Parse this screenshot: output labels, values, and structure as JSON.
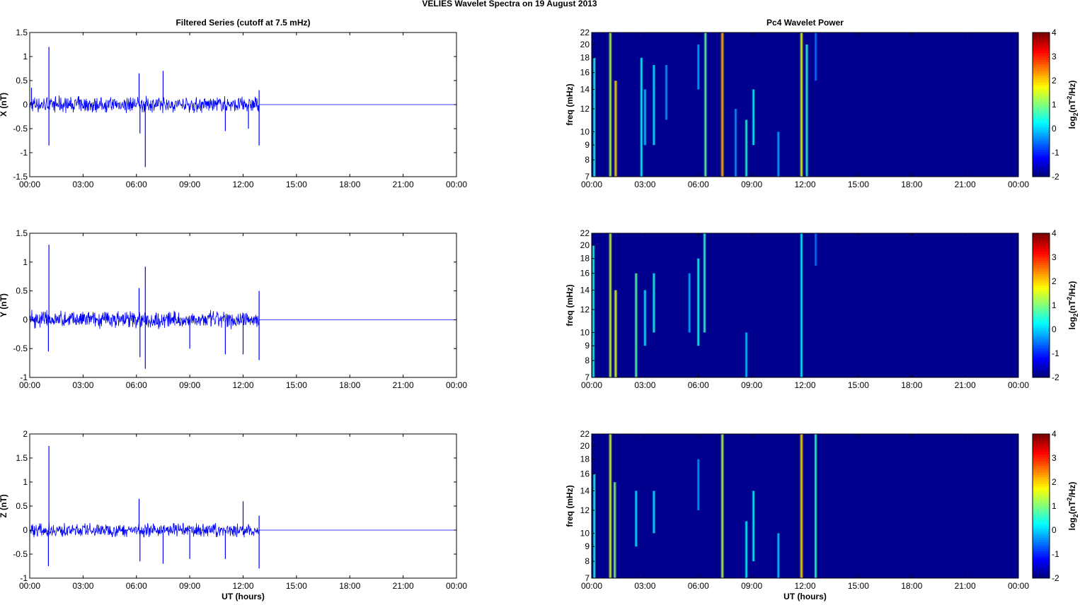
{
  "figure_title": "VELIES Wavelet Spectra on 19 August    2013",
  "chart_data": [
    {
      "type": "line",
      "title": "Filtered Series (cutoff at 7.5 mHz)",
      "ylabel": "X (nT)",
      "xlabel": "",
      "ylim": [
        -1.5,
        1.5
      ],
      "yticks": [
        "-1.5",
        "-1",
        "-0.5",
        "0",
        "0.5",
        "1",
        "1.5"
      ],
      "xlim_hours": [
        0,
        24
      ],
      "xticks": [
        "00:00",
        "03:00",
        "06:00",
        "09:00",
        "12:00",
        "15:00",
        "18:00",
        "21:00",
        "00:00"
      ],
      "data_end_hours": 12.9,
      "noise_amplitude": 0.12,
      "color": "#0000ff",
      "spikes": [
        {
          "t": 1.08,
          "v": 1.2
        },
        {
          "t": 1.08,
          "v": -0.85
        },
        {
          "t": 0.1,
          "v": 0.35
        },
        {
          "t": 6.15,
          "v": 0.65
        },
        {
          "t": 6.2,
          "v": -0.6
        },
        {
          "t": 6.5,
          "v": -1.3
        },
        {
          "t": 7.5,
          "v": 0.7
        },
        {
          "t": 11.0,
          "v": -0.55
        },
        {
          "t": 12.3,
          "v": -0.5
        },
        {
          "t": 12.9,
          "v": -0.85
        },
        {
          "t": 12.9,
          "v": 0.3
        }
      ]
    },
    {
      "type": "heatmap",
      "title": "Pc4 Wavelet Power",
      "ylabel": "freq (mHz)",
      "xlabel": "",
      "ylim_mHz": [
        7,
        22
      ],
      "yticks": [
        "7",
        "8",
        "9",
        "10",
        "12",
        "14",
        "16",
        "18",
        "20",
        "22"
      ],
      "xticks": [
        "00:00",
        "03:00",
        "06:00",
        "09:00",
        "12:00",
        "15:00",
        "18:00",
        "21:00",
        "00:00"
      ],
      "colorbar": {
        "label": "log2(nT2/Hz)",
        "range": [
          -2,
          4
        ],
        "ticks": [
          "-2",
          "-1",
          "0",
          "1",
          "2",
          "3",
          "4"
        ]
      },
      "bursts": [
        {
          "t": 0.15,
          "f0": 7,
          "f1": 18,
          "p": 0.5
        },
        {
          "t": 1.05,
          "f0": 7,
          "f1": 22,
          "p": 1.3
        },
        {
          "t": 1.35,
          "f0": 7,
          "f1": 15,
          "p": 2.0
        },
        {
          "t": 2.8,
          "f0": 7,
          "f1": 18,
          "p": 0.3
        },
        {
          "t": 3.0,
          "f0": 9,
          "f1": 14,
          "p": 0.0
        },
        {
          "t": 3.5,
          "f0": 9,
          "f1": 17,
          "p": 0.2
        },
        {
          "t": 4.2,
          "f0": 11,
          "f1": 17,
          "p": -0.3
        },
        {
          "t": 6.0,
          "f0": 14,
          "f1": 20,
          "p": -0.2
        },
        {
          "t": 6.4,
          "f0": 7,
          "f1": 22,
          "p": 0.8
        },
        {
          "t": 7.35,
          "f0": 7,
          "f1": 22,
          "p": 2.2
        },
        {
          "t": 8.1,
          "f0": 7,
          "f1": 12,
          "p": -0.3
        },
        {
          "t": 8.7,
          "f0": 7,
          "f1": 11,
          "p": 0.5
        },
        {
          "t": 9.1,
          "f0": 9,
          "f1": 14,
          "p": 0.3
        },
        {
          "t": 10.5,
          "f0": 7,
          "f1": 10,
          "p": -0.2
        },
        {
          "t": 11.8,
          "f0": 7,
          "f1": 22,
          "p": 1.6
        },
        {
          "t": 12.1,
          "f0": 7,
          "f1": 20,
          "p": 0.5
        },
        {
          "t": 12.6,
          "f0": 15,
          "f1": 22,
          "p": -0.5
        }
      ]
    },
    {
      "type": "line",
      "title": "",
      "ylabel": "Y (nT)",
      "xlabel": "",
      "ylim": [
        -1,
        1.5
      ],
      "yticks": [
        "-1",
        "-0.5",
        "0",
        "0.5",
        "1",
        "1.5"
      ],
      "xticks": [
        "00:00",
        "03:00",
        "06:00",
        "09:00",
        "12:00",
        "15:00",
        "18:00",
        "21:00",
        "00:00"
      ],
      "data_end_hours": 12.9,
      "noise_amplitude": 0.11,
      "color": "#0000ff",
      "spikes": [
        {
          "t": 1.08,
          "v": 1.3
        },
        {
          "t": 1.05,
          "v": -0.55
        },
        {
          "t": 6.15,
          "v": 0.55
        },
        {
          "t": 6.2,
          "v": -0.65
        },
        {
          "t": 6.5,
          "v": 0.92
        },
        {
          "t": 6.5,
          "v": -0.85
        },
        {
          "t": 9.0,
          "v": -0.5
        },
        {
          "t": 11.0,
          "v": -0.6
        },
        {
          "t": 12.0,
          "v": -0.6
        },
        {
          "t": 12.9,
          "v": 0.5
        },
        {
          "t": 12.9,
          "v": -0.7
        }
      ]
    },
    {
      "type": "heatmap",
      "title": "",
      "ylabel": "freq (mHz)",
      "xlabel": "",
      "ylim_mHz": [
        7,
        22
      ],
      "yticks": [
        "7",
        "8",
        "9",
        "10",
        "12",
        "14",
        "16",
        "18",
        "20",
        "22"
      ],
      "xticks": [
        "00:00",
        "03:00",
        "06:00",
        "09:00",
        "12:00",
        "15:00",
        "18:00",
        "21:00",
        "00:00"
      ],
      "colorbar": {
        "label": "log2(nT2/Hz)",
        "range": [
          -2,
          4
        ],
        "ticks": [
          "-2",
          "-1",
          "0",
          "1",
          "2",
          "3",
          "4"
        ]
      },
      "bursts": [
        {
          "t": 0.1,
          "f0": 7,
          "f1": 20,
          "p": 0.5
        },
        {
          "t": 1.05,
          "f0": 7,
          "f1": 22,
          "p": 1.4
        },
        {
          "t": 1.35,
          "f0": 7,
          "f1": 14,
          "p": 1.6
        },
        {
          "t": 2.5,
          "f0": 7,
          "f1": 16,
          "p": 0.8
        },
        {
          "t": 3.0,
          "f0": 9,
          "f1": 14,
          "p": 0.2
        },
        {
          "t": 3.5,
          "f0": 10,
          "f1": 16,
          "p": 0.4
        },
        {
          "t": 5.5,
          "f0": 10,
          "f1": 16,
          "p": -0.2
        },
        {
          "t": 6.0,
          "f0": 9,
          "f1": 18,
          "p": 0.4
        },
        {
          "t": 6.35,
          "f0": 10,
          "f1": 22,
          "p": 0.6
        },
        {
          "t": 8.7,
          "f0": 7,
          "f1": 10,
          "p": 0.0
        },
        {
          "t": 11.8,
          "f0": 7,
          "f1": 22,
          "p": 0.3
        },
        {
          "t": 12.6,
          "f0": 17,
          "f1": 22,
          "p": -0.5
        }
      ]
    },
    {
      "type": "line",
      "title": "",
      "ylabel": "Z (nT)",
      "xlabel": "UT (hours)",
      "ylim": [
        -1,
        2
      ],
      "yticks": [
        "-1",
        "-0.5",
        "0",
        "0.5",
        "1",
        "1.5",
        "2"
      ],
      "xticks": [
        "00:00",
        "03:00",
        "06:00",
        "09:00",
        "12:00",
        "15:00",
        "18:00",
        "21:00",
        "00:00"
      ],
      "data_end_hours": 12.9,
      "noise_amplitude": 0.1,
      "color": "#0000ff",
      "spikes": [
        {
          "t": 1.08,
          "v": 1.75
        },
        {
          "t": 1.05,
          "v": -0.75
        },
        {
          "t": 6.15,
          "v": 0.65
        },
        {
          "t": 6.2,
          "v": -0.65
        },
        {
          "t": 7.5,
          "v": -0.7
        },
        {
          "t": 9.0,
          "v": -0.6
        },
        {
          "t": 11.0,
          "v": -0.6
        },
        {
          "t": 12.0,
          "v": 0.6
        },
        {
          "t": 12.9,
          "v": -0.8
        },
        {
          "t": 12.9,
          "v": 0.3
        }
      ]
    },
    {
      "type": "heatmap",
      "title": "",
      "ylabel": "freq (mHz)",
      "xlabel": "UT (hours)",
      "ylim_mHz": [
        7,
        22
      ],
      "yticks": [
        "7",
        "8",
        "9",
        "10",
        "12",
        "14",
        "16",
        "18",
        "20",
        "22"
      ],
      "xticks": [
        "00:00",
        "03:00",
        "06:00",
        "09:00",
        "12:00",
        "15:00",
        "18:00",
        "21:00",
        "00:00"
      ],
      "colorbar": {
        "label": "log2(nT2/Hz)",
        "range": [
          -2,
          4
        ],
        "ticks": [
          "-2",
          "-1",
          "0",
          "1",
          "2",
          "3",
          "4"
        ]
      },
      "bursts": [
        {
          "t": 0.15,
          "f0": 7,
          "f1": 16,
          "p": 0.5
        },
        {
          "t": 1.05,
          "f0": 7,
          "f1": 22,
          "p": 1.5
        },
        {
          "t": 1.3,
          "f0": 7,
          "f1": 15,
          "p": 1.0
        },
        {
          "t": 2.5,
          "f0": 9,
          "f1": 14,
          "p": 0.2
        },
        {
          "t": 3.5,
          "f0": 10,
          "f1": 14,
          "p": 0.2
        },
        {
          "t": 6.0,
          "f0": 12,
          "f1": 18,
          "p": -0.3
        },
        {
          "t": 7.35,
          "f0": 7,
          "f1": 22,
          "p": 1.3
        },
        {
          "t": 8.7,
          "f0": 7,
          "f1": 11,
          "p": 0.3
        },
        {
          "t": 9.1,
          "f0": 8,
          "f1": 14,
          "p": 0.3
        },
        {
          "t": 10.5,
          "f0": 7,
          "f1": 10,
          "p": 0.0
        },
        {
          "t": 11.8,
          "f0": 7,
          "f1": 22,
          "p": 2.0
        },
        {
          "t": 12.6,
          "f0": 7,
          "f1": 22,
          "p": 0.6
        }
      ]
    }
  ]
}
